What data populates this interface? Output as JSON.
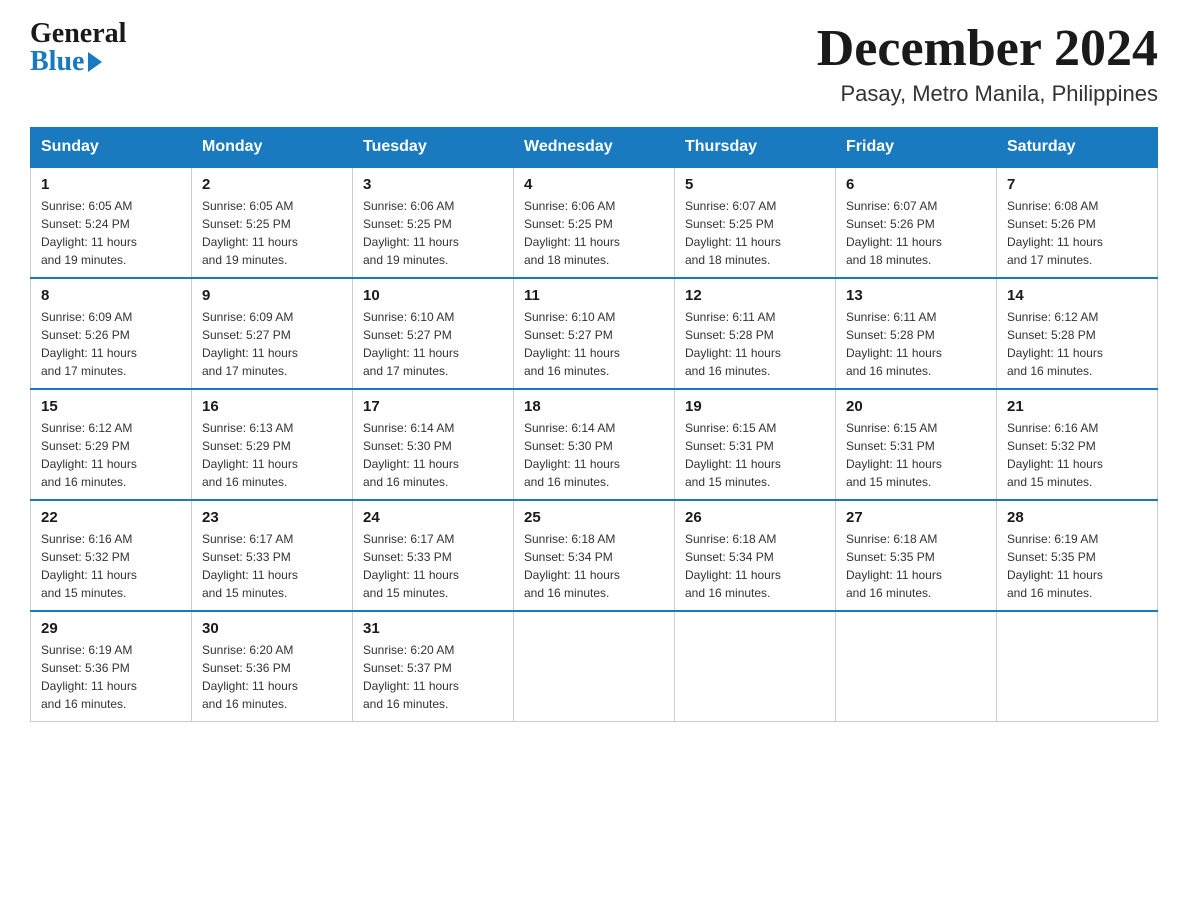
{
  "header": {
    "logo_general": "General",
    "logo_blue": "Blue",
    "month_title": "December 2024",
    "location": "Pasay, Metro Manila, Philippines"
  },
  "days_of_week": [
    "Sunday",
    "Monday",
    "Tuesday",
    "Wednesday",
    "Thursday",
    "Friday",
    "Saturday"
  ],
  "weeks": [
    [
      {
        "day": "1",
        "sunrise": "6:05 AM",
        "sunset": "5:24 PM",
        "daylight": "11 hours and 19 minutes."
      },
      {
        "day": "2",
        "sunrise": "6:05 AM",
        "sunset": "5:25 PM",
        "daylight": "11 hours and 19 minutes."
      },
      {
        "day": "3",
        "sunrise": "6:06 AM",
        "sunset": "5:25 PM",
        "daylight": "11 hours and 19 minutes."
      },
      {
        "day": "4",
        "sunrise": "6:06 AM",
        "sunset": "5:25 PM",
        "daylight": "11 hours and 18 minutes."
      },
      {
        "day": "5",
        "sunrise": "6:07 AM",
        "sunset": "5:25 PM",
        "daylight": "11 hours and 18 minutes."
      },
      {
        "day": "6",
        "sunrise": "6:07 AM",
        "sunset": "5:26 PM",
        "daylight": "11 hours and 18 minutes."
      },
      {
        "day": "7",
        "sunrise": "6:08 AM",
        "sunset": "5:26 PM",
        "daylight": "11 hours and 17 minutes."
      }
    ],
    [
      {
        "day": "8",
        "sunrise": "6:09 AM",
        "sunset": "5:26 PM",
        "daylight": "11 hours and 17 minutes."
      },
      {
        "day": "9",
        "sunrise": "6:09 AM",
        "sunset": "5:27 PM",
        "daylight": "11 hours and 17 minutes."
      },
      {
        "day": "10",
        "sunrise": "6:10 AM",
        "sunset": "5:27 PM",
        "daylight": "11 hours and 17 minutes."
      },
      {
        "day": "11",
        "sunrise": "6:10 AM",
        "sunset": "5:27 PM",
        "daylight": "11 hours and 16 minutes."
      },
      {
        "day": "12",
        "sunrise": "6:11 AM",
        "sunset": "5:28 PM",
        "daylight": "11 hours and 16 minutes."
      },
      {
        "day": "13",
        "sunrise": "6:11 AM",
        "sunset": "5:28 PM",
        "daylight": "11 hours and 16 minutes."
      },
      {
        "day": "14",
        "sunrise": "6:12 AM",
        "sunset": "5:28 PM",
        "daylight": "11 hours and 16 minutes."
      }
    ],
    [
      {
        "day": "15",
        "sunrise": "6:12 AM",
        "sunset": "5:29 PM",
        "daylight": "11 hours and 16 minutes."
      },
      {
        "day": "16",
        "sunrise": "6:13 AM",
        "sunset": "5:29 PM",
        "daylight": "11 hours and 16 minutes."
      },
      {
        "day": "17",
        "sunrise": "6:14 AM",
        "sunset": "5:30 PM",
        "daylight": "11 hours and 16 minutes."
      },
      {
        "day": "18",
        "sunrise": "6:14 AM",
        "sunset": "5:30 PM",
        "daylight": "11 hours and 16 minutes."
      },
      {
        "day": "19",
        "sunrise": "6:15 AM",
        "sunset": "5:31 PM",
        "daylight": "11 hours and 15 minutes."
      },
      {
        "day": "20",
        "sunrise": "6:15 AM",
        "sunset": "5:31 PM",
        "daylight": "11 hours and 15 minutes."
      },
      {
        "day": "21",
        "sunrise": "6:16 AM",
        "sunset": "5:32 PM",
        "daylight": "11 hours and 15 minutes."
      }
    ],
    [
      {
        "day": "22",
        "sunrise": "6:16 AM",
        "sunset": "5:32 PM",
        "daylight": "11 hours and 15 minutes."
      },
      {
        "day": "23",
        "sunrise": "6:17 AM",
        "sunset": "5:33 PM",
        "daylight": "11 hours and 15 minutes."
      },
      {
        "day": "24",
        "sunrise": "6:17 AM",
        "sunset": "5:33 PM",
        "daylight": "11 hours and 15 minutes."
      },
      {
        "day": "25",
        "sunrise": "6:18 AM",
        "sunset": "5:34 PM",
        "daylight": "11 hours and 16 minutes."
      },
      {
        "day": "26",
        "sunrise": "6:18 AM",
        "sunset": "5:34 PM",
        "daylight": "11 hours and 16 minutes."
      },
      {
        "day": "27",
        "sunrise": "6:18 AM",
        "sunset": "5:35 PM",
        "daylight": "11 hours and 16 minutes."
      },
      {
        "day": "28",
        "sunrise": "6:19 AM",
        "sunset": "5:35 PM",
        "daylight": "11 hours and 16 minutes."
      }
    ],
    [
      {
        "day": "29",
        "sunrise": "6:19 AM",
        "sunset": "5:36 PM",
        "daylight": "11 hours and 16 minutes."
      },
      {
        "day": "30",
        "sunrise": "6:20 AM",
        "sunset": "5:36 PM",
        "daylight": "11 hours and 16 minutes."
      },
      {
        "day": "31",
        "sunrise": "6:20 AM",
        "sunset": "5:37 PM",
        "daylight": "11 hours and 16 minutes."
      },
      null,
      null,
      null,
      null
    ]
  ],
  "labels": {
    "sunrise": "Sunrise:",
    "sunset": "Sunset:",
    "daylight": "Daylight:"
  }
}
